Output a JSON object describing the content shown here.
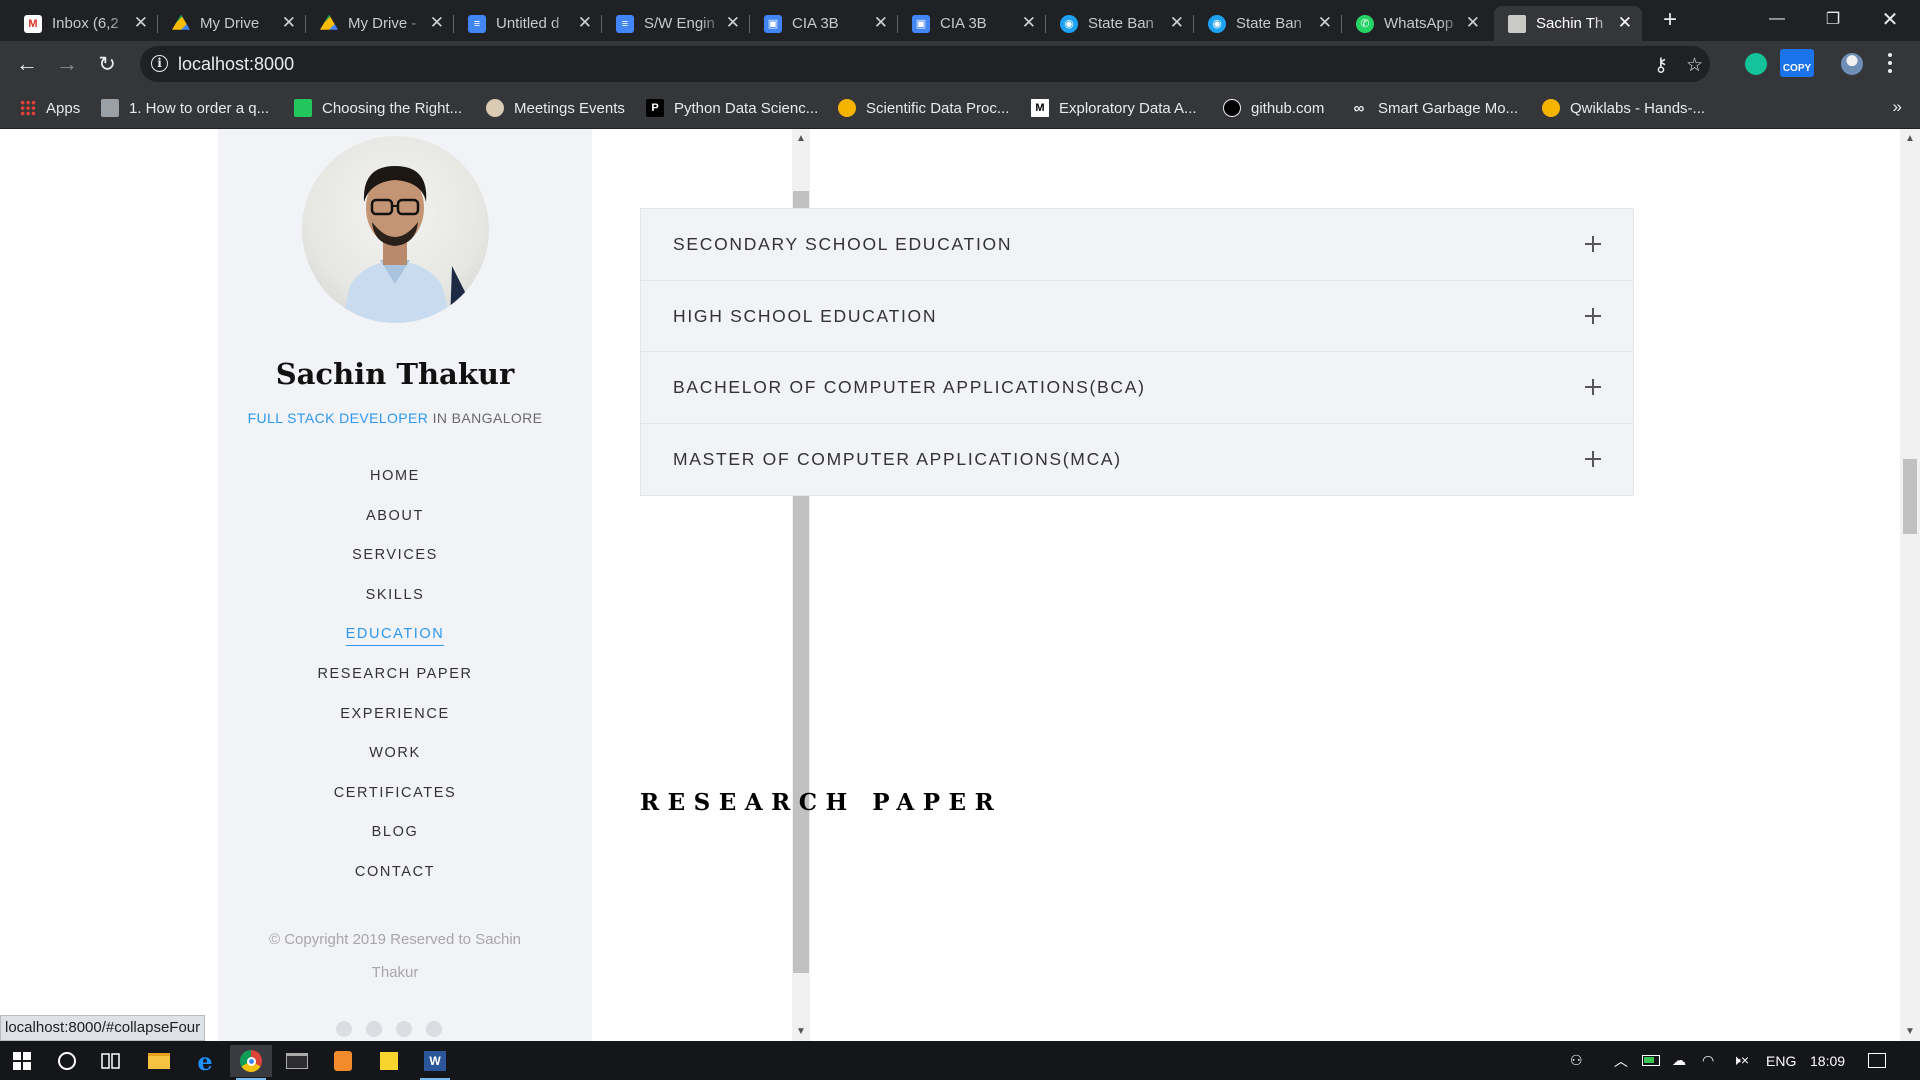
{
  "browser": {
    "tabs": [
      {
        "label": "Inbox (6,2",
        "icon": "gmail-icon"
      },
      {
        "label": "My Drive",
        "icon": "drive-icon"
      },
      {
        "label": "My Drive -",
        "icon": "drive-icon"
      },
      {
        "label": "Untitled d",
        "icon": "docs-icon"
      },
      {
        "label": "S/W Engin",
        "icon": "docs-icon"
      },
      {
        "label": "CIA 3B",
        "icon": "classroom-icon"
      },
      {
        "label": "CIA 3B",
        "icon": "classroom-icon"
      },
      {
        "label": "State Ban",
        "icon": "bank-icon"
      },
      {
        "label": "State Ban",
        "icon": "bank-icon"
      },
      {
        "label": "WhatsApp",
        "icon": "whatsapp-icon"
      },
      {
        "label": "Sachin Th",
        "icon": "avatar-icon"
      }
    ],
    "active_tab": 10,
    "address": "localhost:8000",
    "copy_extension_label": "COPY",
    "bookmarks": [
      {
        "label": "Apps",
        "icon": "apps-grid-icon"
      },
      {
        "label": "1. How to order a q...",
        "icon": "bookmark-page-icon"
      },
      {
        "label": "Choosing the Right...",
        "icon": "bookmark-green-icon"
      },
      {
        "label": "Meetings Events",
        "icon": "bookmark-circle-icon"
      },
      {
        "label": "Python Data Scienc...",
        "icon": "bookmark-p-icon"
      },
      {
        "label": "Scientific Data Proc...",
        "icon": "bookmark-yellow-icon"
      },
      {
        "label": "Exploratory Data A...",
        "icon": "medium-icon"
      },
      {
        "label": "github.com",
        "icon": "github-icon"
      },
      {
        "label": "Smart Garbage Mo...",
        "icon": "link-icon"
      },
      {
        "label": "Qwiklabs - Hands-...",
        "icon": "qwiklabs-icon"
      }
    ],
    "status_url": "localhost:8000/#collapseFour"
  },
  "sidebar": {
    "name": "Sachin Thakur",
    "role_accent": "FULL STACK DEVELOPER",
    "role_rest": " IN BANGALORE",
    "nav": [
      "HOME",
      "ABOUT",
      "SERVICES",
      "SKILLS",
      "EDUCATION",
      "RESEARCH PAPER",
      "EXPERIENCE",
      "WORK",
      "CERTIFICATES",
      "BLOG",
      "CONTACT"
    ],
    "active_nav": "EDUCATION",
    "copyright": "© Copyright 2019 Reserved to Sachin Thakur"
  },
  "main": {
    "education": [
      "SECONDARY SCHOOL EDUCATION",
      "HIGH SCHOOL EDUCATION",
      "BACHELOR OF COMPUTER APPLICATIONS(BCA)",
      "MASTER OF COMPUTER APPLICATIONS(MCA)"
    ],
    "next_section_heading": "RESEARCH PAPER"
  },
  "taskbar": {
    "language": "ENG",
    "time": "18:09"
  },
  "colors": {
    "accent": "#2c98f0",
    "sidebar_bg": "#f2f3f7",
    "chrome_dark": "#202124",
    "chrome_toolbar": "#35363a",
    "taskbar": "#15161a"
  }
}
